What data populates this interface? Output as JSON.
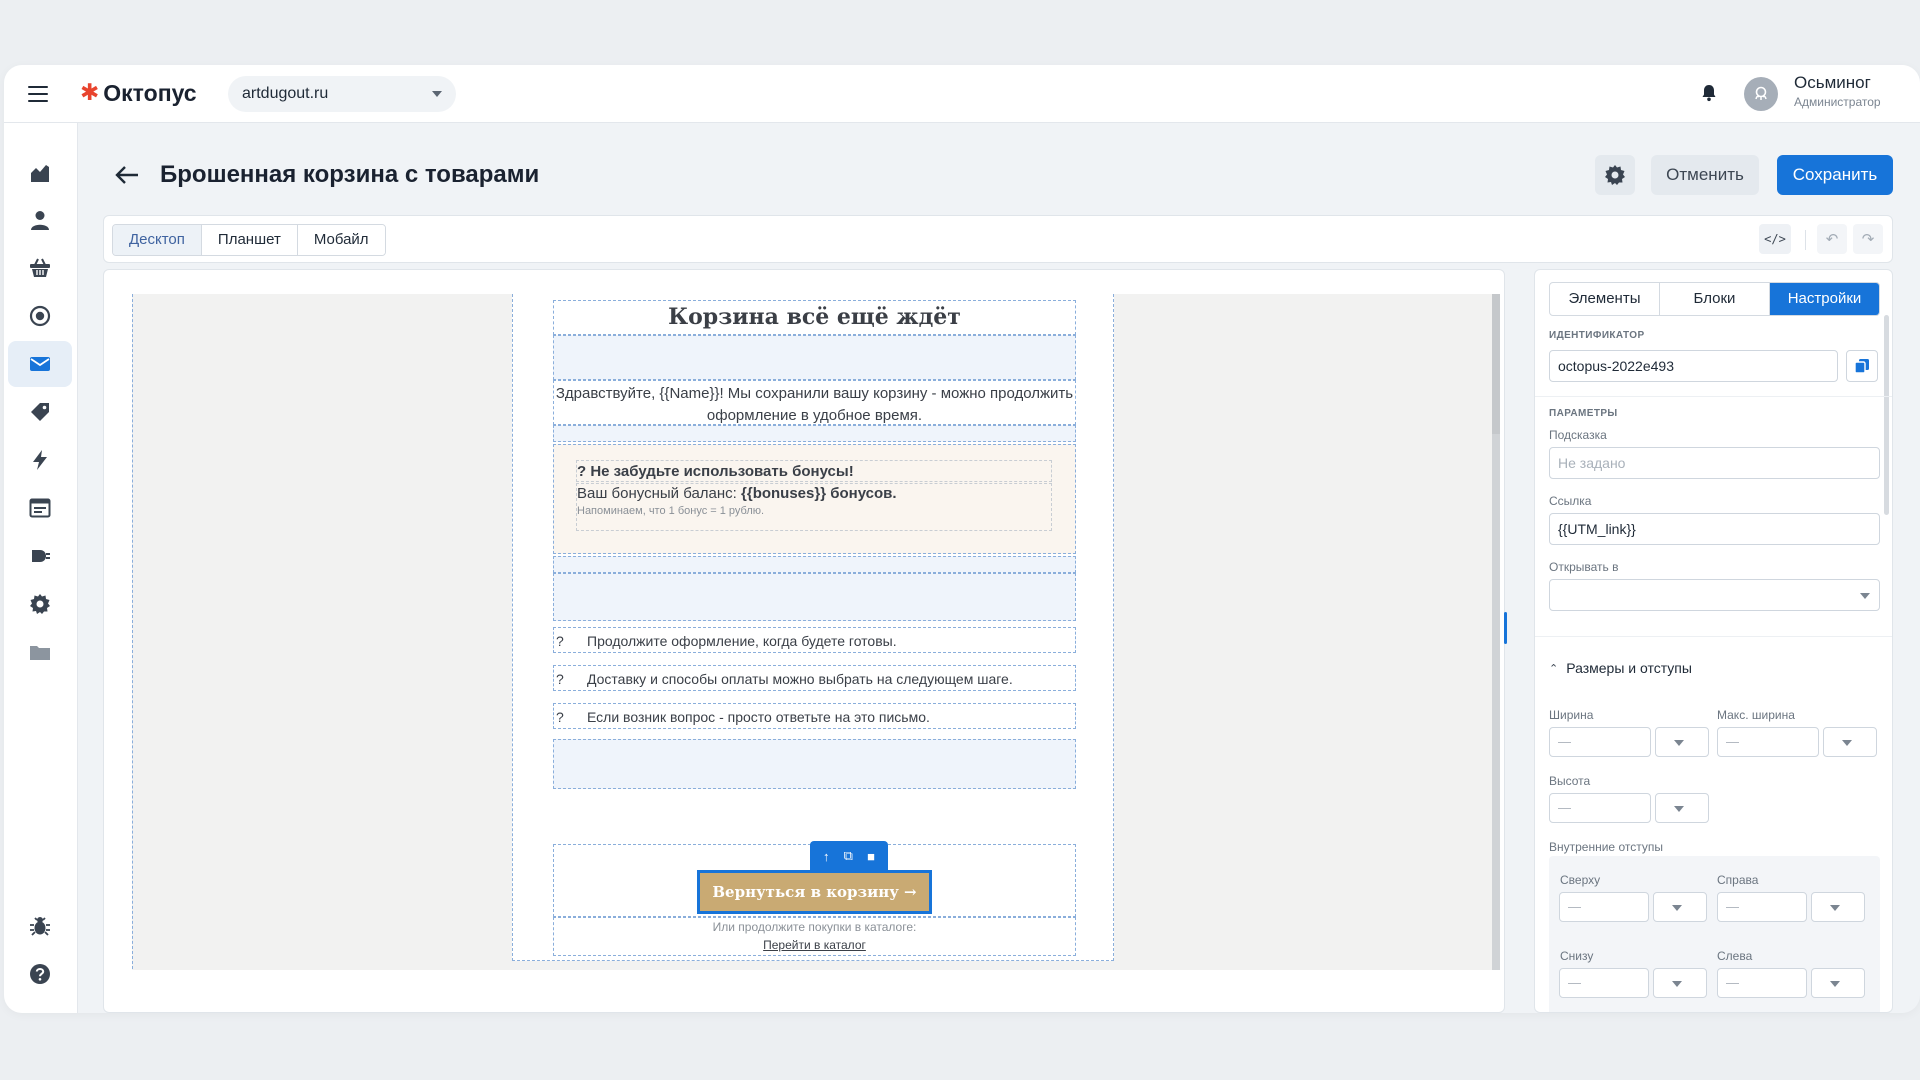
{
  "topbar": {
    "brand": "Октопус",
    "site": "artdugout.ru",
    "user_name": "Осьминог",
    "user_role": "Администратор"
  },
  "sidebar": {
    "items": [
      {
        "icon": "analytics-icon",
        "active": false
      },
      {
        "icon": "user-icon",
        "active": false
      },
      {
        "icon": "basket-icon",
        "active": false
      },
      {
        "icon": "target-icon",
        "active": false
      },
      {
        "icon": "mail-icon",
        "active": true
      },
      {
        "icon": "tag-icon",
        "active": false
      },
      {
        "icon": "lightning-icon",
        "active": false
      },
      {
        "icon": "form-icon",
        "active": false
      },
      {
        "icon": "plugin-icon",
        "active": false
      },
      {
        "icon": "gear-icon",
        "active": false
      },
      {
        "icon": "folder-icon",
        "active": false
      },
      {
        "icon": "bug-icon",
        "active": false
      },
      {
        "icon": "help-icon",
        "active": false
      }
    ]
  },
  "header": {
    "title": "Брошенная корзина с товарами",
    "cancel_label": "Отменить",
    "save_label": "Сохранить"
  },
  "device_tabs": {
    "desktop": "Десктоп",
    "tablet": "Планшет",
    "mobile": "Мобайл",
    "code_label": "</>"
  },
  "email": {
    "heading": "Корзина всё ещё ждёт",
    "greeting": "Здравствуйте, {{Name}}! Мы сохранили вашу корзину - можно продолжить оформление в удобное время.",
    "bonus_title": "? Не забудьте использовать бонусы!",
    "bonus_balance_prefix": "Ваш бонусный баланс: ",
    "bonus_balance_value": "{{bonuses}} бонусов.",
    "bonus_note": "Напоминаем, что 1 бонус = 1 рублю.",
    "list": [
      {
        "marker": "?",
        "text": "Продолжите оформление, когда будете готовы."
      },
      {
        "marker": "?",
        "text": "Доставку и способы оплаты можно выбрать на следующем шаге."
      },
      {
        "marker": "?",
        "text": "Если возник вопрос - просто ответьте на это письмо."
      }
    ],
    "cta": "Вернуться в корзину →",
    "catalog_note": "Или продолжите покупки в каталоге:",
    "catalog_link": "Перейти в каталог"
  },
  "settings": {
    "tabs": {
      "elements": "Элементы",
      "blocks": "Блоки",
      "settings": "Настройки"
    },
    "identifier_label": "ИДЕНТИФИКАТОР",
    "identifier_value": "octopus-2022e493",
    "params_label": "ПАРАМЕТРЫ",
    "hint_label": "Подсказка",
    "hint_placeholder": "Не задано",
    "link_label": "Ссылка",
    "link_value": "{{UTM_link}}",
    "open_in_label": "Открывать в",
    "sizes_section": "Размеры и отступы",
    "width_label": "Ширина",
    "max_width_label": "Макс. ширина",
    "height_label": "Высота",
    "padding_label": "Внутренние отступы",
    "top_label": "Сверху",
    "right_label": "Справа",
    "bottom_label": "Снизу",
    "left_label": "Слева",
    "empty_value": "—"
  },
  "colors": {
    "accent": "#1774d9",
    "brand_star": "#e8442e",
    "cta_fill": "#c9aa73",
    "guide": "#8aaedb"
  }
}
